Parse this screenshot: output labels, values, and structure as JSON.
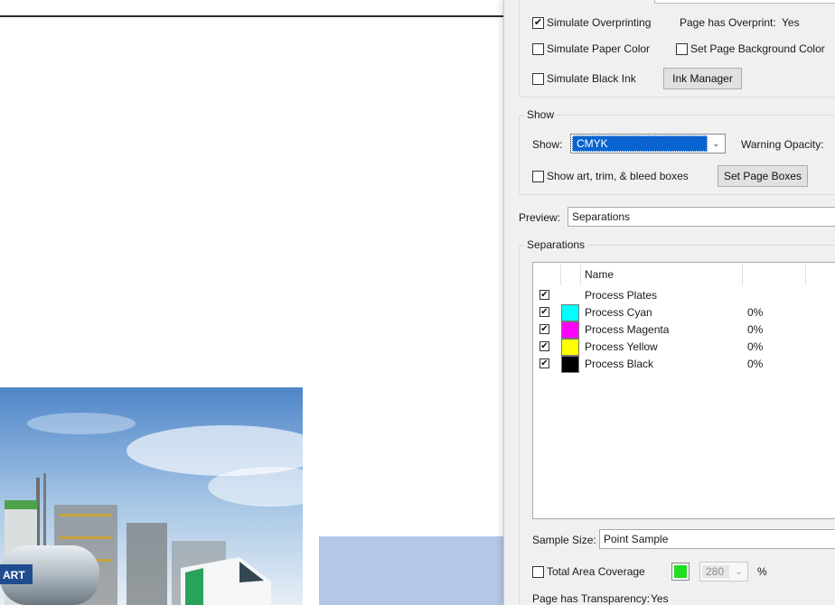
{
  "simulation": {
    "simulate_overprinting": {
      "label": "Simulate Overprinting",
      "checked": true
    },
    "page_has_overprint_label": "Page has Overprint:",
    "page_has_overprint_value": "Yes",
    "simulate_paper_color": {
      "label": "Simulate Paper Color",
      "checked": false
    },
    "set_page_background": {
      "label": "Set Page Background Color",
      "checked": false
    },
    "simulate_black_ink": {
      "label": "Simulate Black Ink",
      "checked": false
    },
    "ink_manager_label": "Ink Manager"
  },
  "show_group": {
    "title": "Show",
    "show_label": "Show:",
    "show_value": "CMYK",
    "warning_opacity_label": "Warning Opacity:",
    "show_boxes": {
      "label": "Show art, trim, & bleed boxes",
      "checked": false
    },
    "set_page_boxes_label": "Set Page Boxes"
  },
  "preview": {
    "label": "Preview:",
    "value": "Separations"
  },
  "separations": {
    "title": "Separations",
    "name_header": "Name",
    "rows": [
      {
        "name": "Process Plates",
        "checked": true,
        "percent": "",
        "color": ""
      },
      {
        "name": "Process Cyan",
        "checked": true,
        "percent": "0%",
        "color": "#00ffff"
      },
      {
        "name": "Process Magenta",
        "checked": true,
        "percent": "0%",
        "color": "#ff00ff"
      },
      {
        "name": "Process Yellow",
        "checked": true,
        "percent": "0%",
        "color": "#ffff00"
      },
      {
        "name": "Process Black",
        "checked": true,
        "percent": "0%",
        "color": "#000000"
      }
    ]
  },
  "sample_size": {
    "label": "Sample Size:",
    "value": "Point Sample"
  },
  "coverage": {
    "label": "Total Area Coverage",
    "checked": false,
    "color": "#22dd22",
    "value": "280",
    "unit": "%"
  },
  "transparency": {
    "label": "Page has Transparency:",
    "value": "Yes"
  },
  "document": {
    "badge_text": "ART"
  }
}
